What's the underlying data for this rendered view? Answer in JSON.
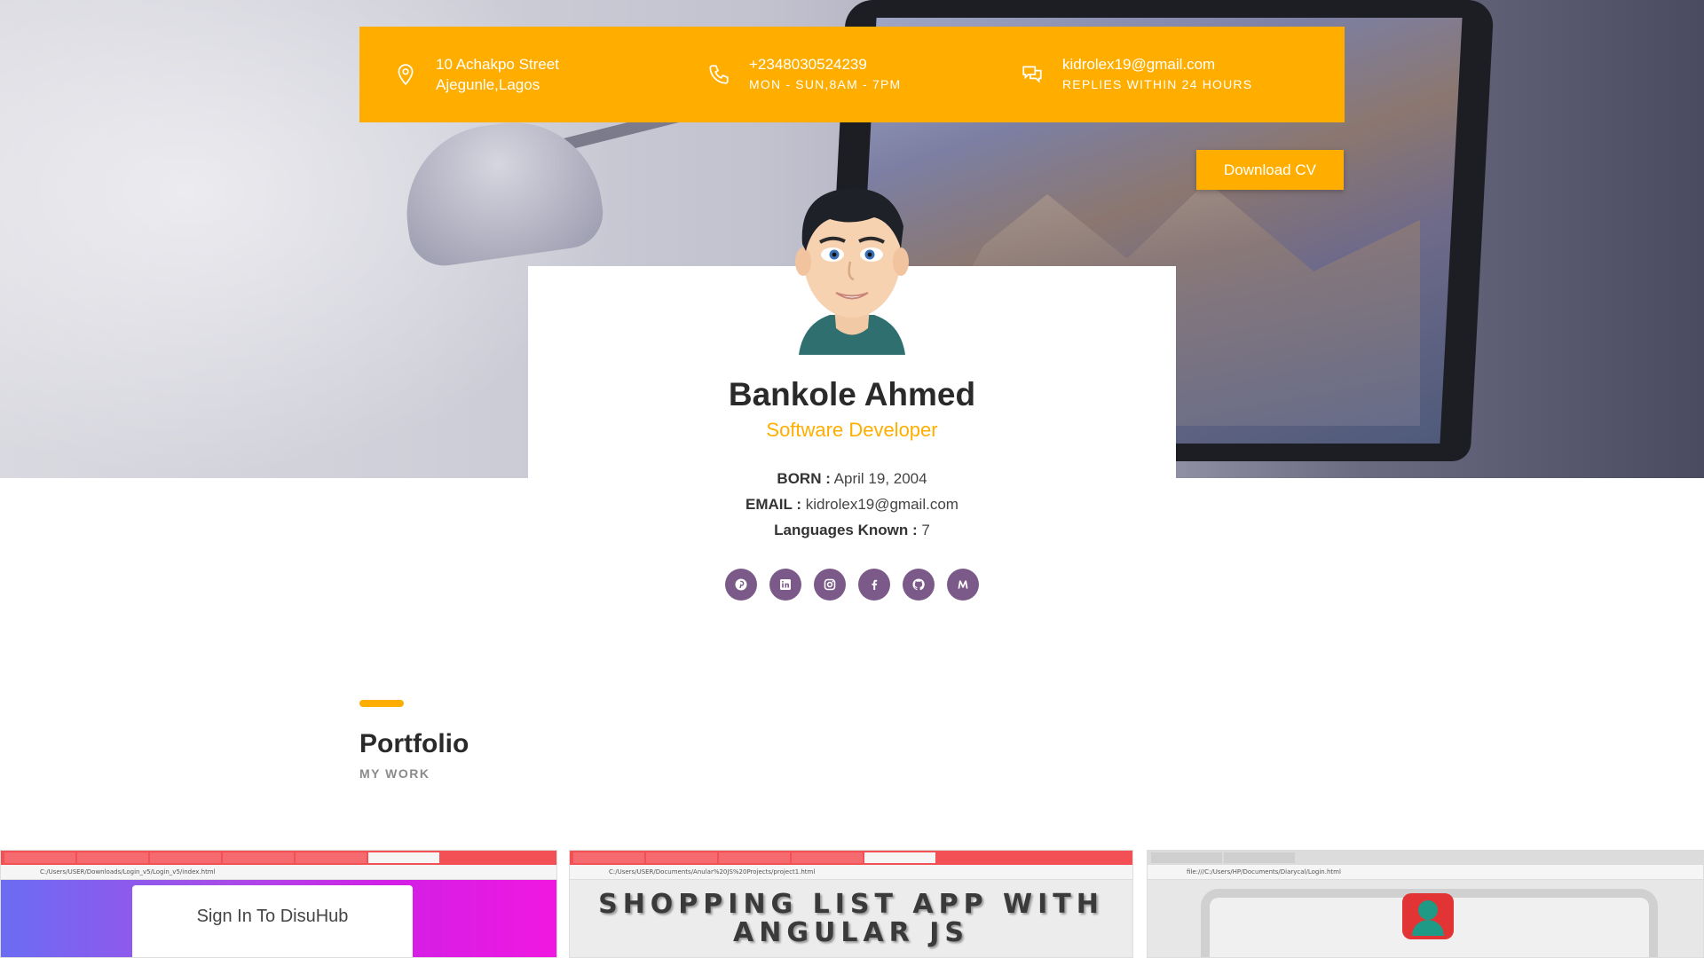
{
  "contact": {
    "address_line1": "10 Achakpo Street",
    "address_line2": "Ajegunle,Lagos",
    "phone": "+2348030524239",
    "hours": "MON - SUN,8AM - 7PM",
    "email": "kidrolex19@gmail.com",
    "reply_note": "REPLIES WITHIN 24 HOURS"
  },
  "download_cv_label": "Download CV",
  "profile": {
    "name": "Bankole Ahmed",
    "role": "Software Developer",
    "born_label": "BORN :",
    "born_value": "April 19, 2004",
    "email_label": "EMAIL :",
    "email_value": "kidrolex19@gmail.com",
    "languages_label": "Languages Known :",
    "languages_value": "7"
  },
  "socials": [
    {
      "name": "pinterest-icon"
    },
    {
      "name": "linkedin-icon"
    },
    {
      "name": "instagram-icon"
    },
    {
      "name": "facebook-icon"
    },
    {
      "name": "github-icon"
    },
    {
      "name": "medium-icon"
    }
  ],
  "portfolio": {
    "title": "Portfolio",
    "subtitle": "MY WORK",
    "items": [
      {
        "address": "C:/Users/USER/Downloads/Login_v5/Login_v5/index.html",
        "card_text": "Sign In To DisuHub"
      },
      {
        "address": "C:/Users/USER/Documents/Anular%20JS%20Projects/project1.html",
        "heading_line1": "SHOPPING LIST APP WITH",
        "heading_line2": "ANGULAR JS"
      },
      {
        "address": "file:///C:/Users/HP/Documents/Diarycal/Login.html"
      }
    ]
  },
  "colors": {
    "accent": "#ffae00",
    "social_bg": "#7b5a8a",
    "browser_tabs": "#f25055"
  }
}
